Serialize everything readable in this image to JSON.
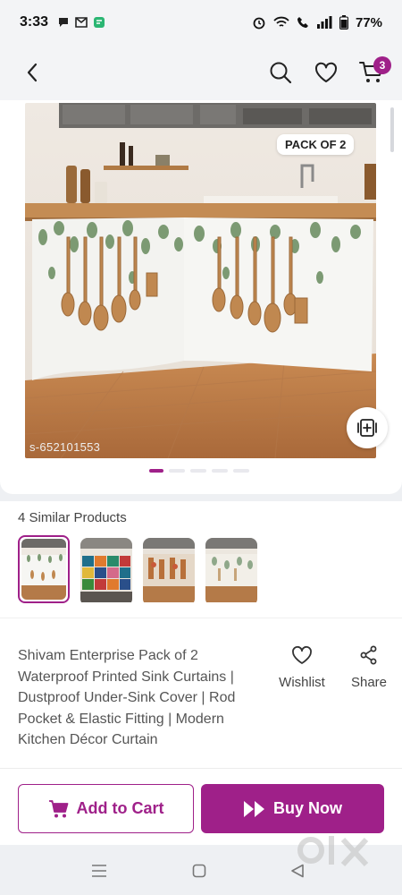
{
  "status_bar": {
    "time": "3:33",
    "battery": "77%"
  },
  "nav": {
    "cart_count": "3"
  },
  "product_image": {
    "pack_badge": "PACK OF 2",
    "sku": "s-652101553",
    "slide_count": 5,
    "active_slide": 1
  },
  "similar": {
    "title": "4 Similar Products",
    "thumbnails": [
      "similar-1",
      "similar-2",
      "similar-3",
      "similar-4"
    ]
  },
  "product": {
    "title": "Shivam Enterprise Pack of 2 Waterproof Printed Sink Curtains | Dustproof Under-Sink Cover | Rod Pocket & Elastic Fitting | Modern Kitchen Décor Curtain"
  },
  "actions": {
    "wishlist_label": "Wishlist",
    "share_label": "Share"
  },
  "cta": {
    "add_to_cart_label": "Add to Cart",
    "buy_now_label": "Buy Now"
  },
  "colors": {
    "brand": "#9f2089",
    "background": "#eef0f3"
  }
}
